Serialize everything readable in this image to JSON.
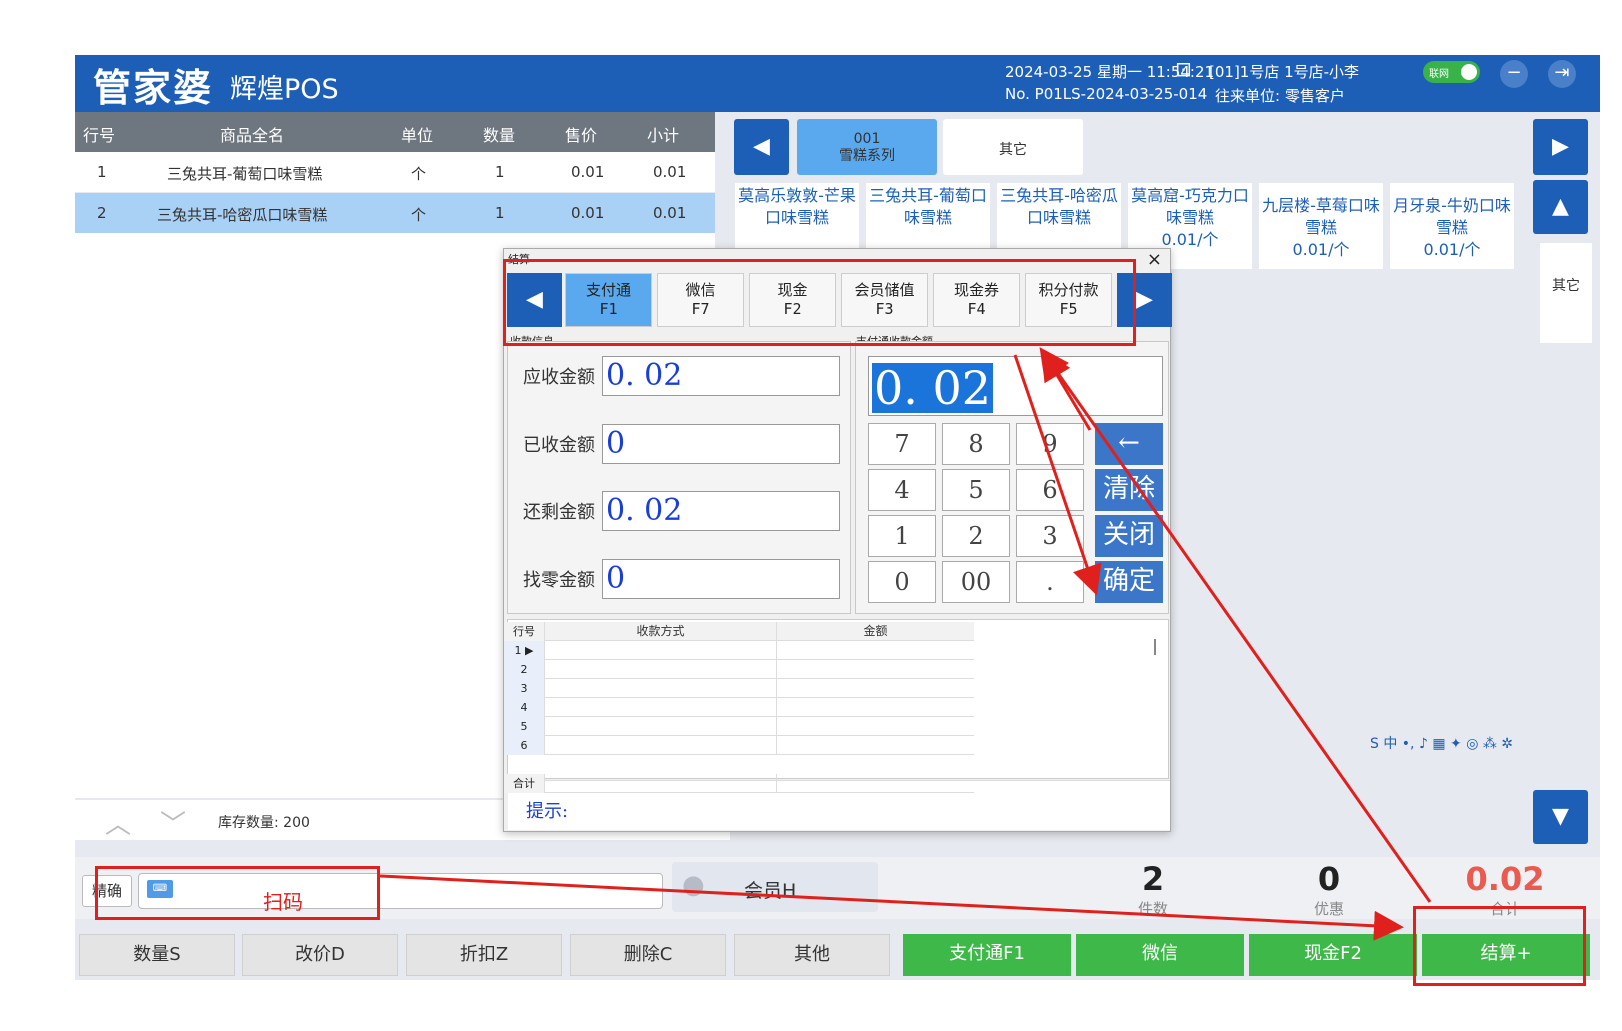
{
  "header": {
    "logo": "管家婆",
    "product": "辉煌POS",
    "datetime": "2024-03-25 星期一 11:54:21",
    "store": "[01]1号店 1号店-小李",
    "network": "联网",
    "order_no": "No. P01LS-2024-03-25-014",
    "customer": "往来单位: 零售客户",
    "minimize_icon": "−",
    "logout_icon": "⇥"
  },
  "table": {
    "headers": [
      "行号",
      "商品全名",
      "单位",
      "数量",
      "售价",
      "小计"
    ],
    "rows": [
      {
        "no": "1",
        "name": "三兔共耳-葡萄口味雪糕",
        "unit": "个",
        "qty": "1",
        "price": "0.01",
        "subtotal": "0.01"
      },
      {
        "no": "2",
        "name": "三兔共耳-哈密瓜口味雪糕",
        "unit": "个",
        "qty": "1",
        "price": "0.01",
        "subtotal": "0.01"
      }
    ]
  },
  "categories": [
    {
      "label": "001\n雪糕系列"
    },
    {
      "label": "其它"
    }
  ],
  "products": [
    {
      "name": "莫高乐敦敦-芒果口味雪糕",
      "price": ""
    },
    {
      "name": "三兔共耳-葡萄口味雪糕",
      "price": ""
    },
    {
      "name": "三兔共耳-哈密瓜口味雪糕",
      "price": ""
    },
    {
      "name": "莫高窟-巧克力口味雪糕",
      "price": "0.01/个"
    },
    {
      "name": "九层楼-草莓口味雪糕",
      "price": "0.01/个"
    },
    {
      "name": "月牙泉-牛奶口味雪糕",
      "price": "0.01/个"
    }
  ],
  "side_other": "其它",
  "stock": {
    "label": "库存数量: 200"
  },
  "scan": {
    "prefix": "精确",
    "annotation": "扫码"
  },
  "member": "会员H",
  "stats": [
    {
      "value": "2",
      "label": "件数"
    },
    {
      "value": "0",
      "label": "优惠"
    },
    {
      "value": "0.02",
      "label": "合计"
    }
  ],
  "func_buttons": [
    "数量S",
    "改价D",
    "折扣Z",
    "删除C",
    "其他"
  ],
  "pay_buttons": [
    "支付通F1",
    "微信",
    "现金F2",
    "结算+"
  ],
  "dialog": {
    "title": "结算",
    "close": "×",
    "tabs": [
      {
        "name": "支付通",
        "key": "F1"
      },
      {
        "name": "微信",
        "key": "F7"
      },
      {
        "name": "现金",
        "key": "F2"
      },
      {
        "name": "会员储值",
        "key": "F3"
      },
      {
        "name": "现金券",
        "key": "F4"
      },
      {
        "name": "积分付款",
        "key": "F5"
      }
    ],
    "info_group": "收款信息",
    "amount_group": "支付通收款金额",
    "fields": [
      {
        "label": "应收金额",
        "value": "0. 02"
      },
      {
        "label": "已收金额",
        "value": "0"
      },
      {
        "label": "还剩金额",
        "value": "0. 02"
      },
      {
        "label": "找零金额",
        "value": "0"
      }
    ],
    "display": "0. 02",
    "keys": [
      "7",
      "8",
      "9",
      "4",
      "5",
      "6",
      "1",
      "2",
      "3",
      "0",
      "00",
      "."
    ],
    "fkeys": [
      "←",
      "清除",
      "关闭",
      "确定"
    ],
    "grid_headers": [
      "行号",
      "收款方式",
      "金额"
    ],
    "grid_rows": [
      "1",
      "2",
      "3",
      "4",
      "5",
      "6"
    ],
    "grid_total": "合计",
    "hint": "提示:"
  },
  "ime_bar": "S 中 •, ♪ ▦ ✦ ◎ ⁂ ✲",
  "colors": {
    "brand": "#1d5fb7",
    "pay_green": "#3fb84a",
    "annotation_red": "#e0201c",
    "total_red": "#e95a4f"
  }
}
